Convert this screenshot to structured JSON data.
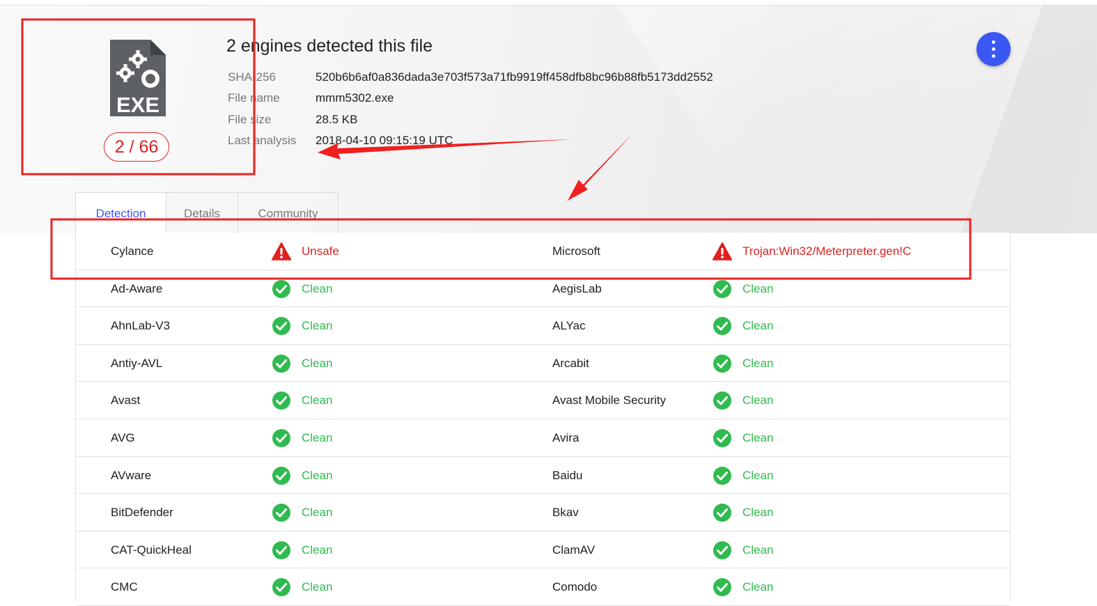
{
  "header": {
    "title": "2 engines detected this file",
    "score": "2 / 66",
    "file_type_label": "EXE",
    "meta": [
      {
        "label": "SHA-256",
        "value": "520b6b6af0a836dada3e703f573a71fb9919ff458dfb8bc96b88fb5173dd2552"
      },
      {
        "label": "File name",
        "value": "mmm5302.exe"
      },
      {
        "label": "File size",
        "value": "28.5 KB"
      },
      {
        "label": "Last analysis",
        "value": "2018-04-10 09:15:19 UTC"
      }
    ]
  },
  "tabs": [
    {
      "label": "Detection",
      "active": true
    },
    {
      "label": "Details",
      "active": false
    },
    {
      "label": "Community",
      "active": false
    }
  ],
  "rows": [
    [
      {
        "engine": "Cylance",
        "result": "Unsafe",
        "status": "unsafe"
      },
      {
        "engine": "Microsoft",
        "result": "Trojan:Win32/Meterpreter.gen!C",
        "status": "unsafe"
      }
    ],
    [
      {
        "engine": "Ad-Aware",
        "result": "Clean",
        "status": "clean"
      },
      {
        "engine": "AegisLab",
        "result": "Clean",
        "status": "clean"
      }
    ],
    [
      {
        "engine": "AhnLab-V3",
        "result": "Clean",
        "status": "clean"
      },
      {
        "engine": "ALYac",
        "result": "Clean",
        "status": "clean"
      }
    ],
    [
      {
        "engine": "Antiy-AVL",
        "result": "Clean",
        "status": "clean"
      },
      {
        "engine": "Arcabit",
        "result": "Clean",
        "status": "clean"
      }
    ],
    [
      {
        "engine": "Avast",
        "result": "Clean",
        "status": "clean"
      },
      {
        "engine": "Avast Mobile Security",
        "result": "Clean",
        "status": "clean"
      }
    ],
    [
      {
        "engine": "AVG",
        "result": "Clean",
        "status": "clean"
      },
      {
        "engine": "Avira",
        "result": "Clean",
        "status": "clean"
      }
    ],
    [
      {
        "engine": "AVware",
        "result": "Clean",
        "status": "clean"
      },
      {
        "engine": "Baidu",
        "result": "Clean",
        "status": "clean"
      }
    ],
    [
      {
        "engine": "BitDefender",
        "result": "Clean",
        "status": "clean"
      },
      {
        "engine": "Bkav",
        "result": "Clean",
        "status": "clean"
      }
    ],
    [
      {
        "engine": "CAT-QuickHeal",
        "result": "Clean",
        "status": "clean"
      },
      {
        "engine": "ClamAV",
        "result": "Clean",
        "status": "clean"
      }
    ],
    [
      {
        "engine": "CMC",
        "result": "Clean",
        "status": "clean"
      },
      {
        "engine": "Comodo",
        "result": "Clean",
        "status": "clean"
      }
    ]
  ],
  "icons": {
    "file": "exe-file-icon",
    "menu": "more-vertical-icon",
    "clean": "check-circle-icon",
    "unsafe": "warning-triangle-icon"
  },
  "colors": {
    "accent": "#3b57f3",
    "clean": "#2fbb4f",
    "unsafe": "#e0211f",
    "annotation": "#f02020"
  }
}
